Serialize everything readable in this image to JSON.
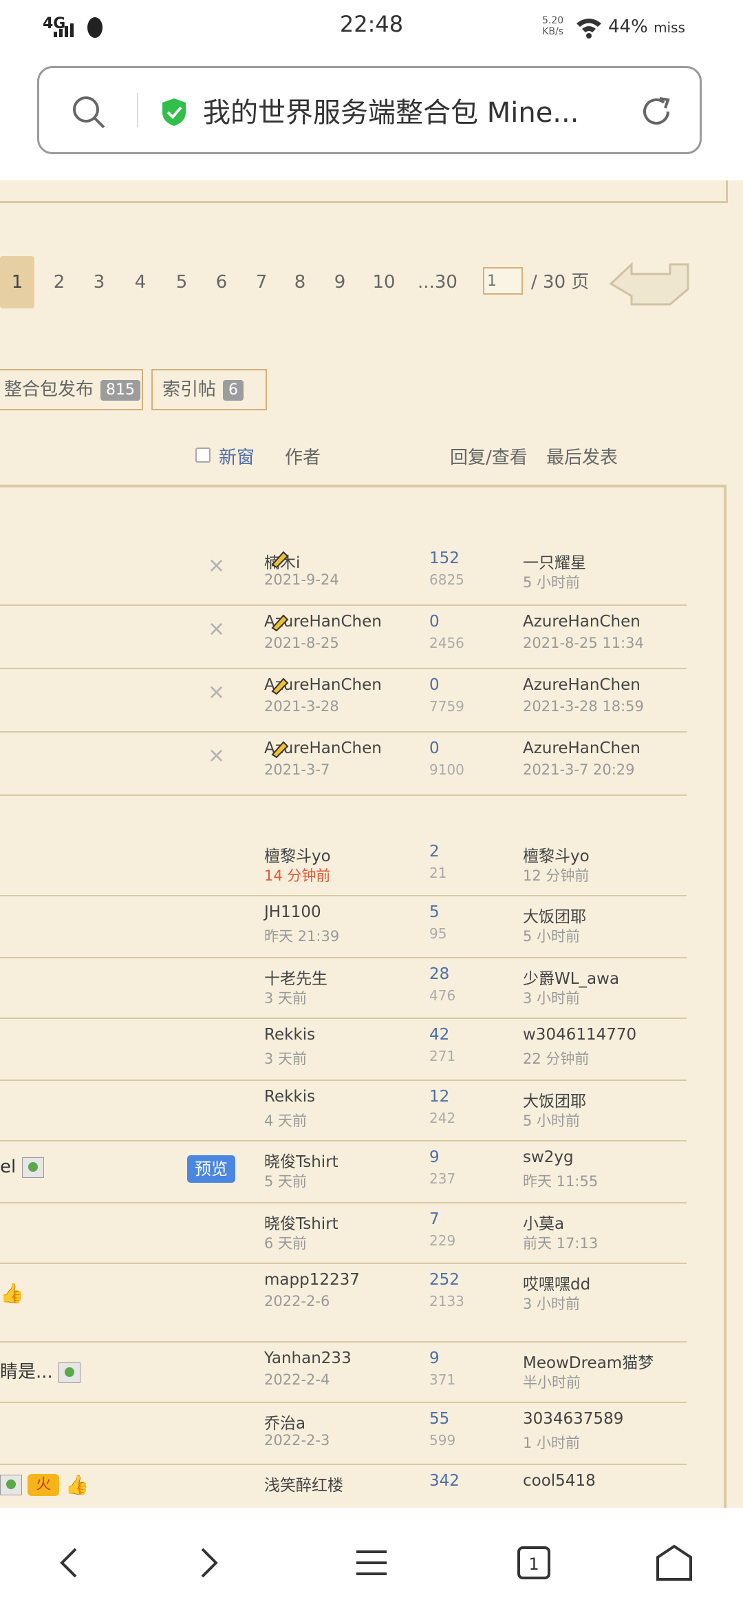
{
  "status": {
    "network": "4G",
    "time": "22:48",
    "speed_value": "5.20",
    "speed_unit": "KB/s",
    "battery": "44%",
    "extra": "miss"
  },
  "urlbar": {
    "title": "我的世界服务端整合包 Mine...",
    "shield_color": "#2fbf4a"
  },
  "pager": {
    "pages": [
      "1",
      "2",
      "3",
      "4",
      "5",
      "6",
      "7",
      "8",
      "9",
      "10",
      "...30"
    ],
    "current": "1",
    "input_value": "1",
    "total": "/ 30 页"
  },
  "chips": [
    {
      "label": "整合包发布",
      "count": "815"
    },
    {
      "label": "索引帖",
      "count": "6"
    }
  ],
  "header": {
    "new_window": "新窗",
    "author": "作者",
    "reply_view": "回复/查看",
    "last_post": "最后发表"
  },
  "rows": [
    {
      "author": "楠木i",
      "date": "2021-9-24",
      "replies": "152",
      "views": "6825",
      "last_user": "一只耀星",
      "last_time": "5 小时前",
      "pinned": true
    },
    {
      "author": "AzureHanChen",
      "date": "2021-8-25",
      "replies": "0",
      "views": "2456",
      "last_user": "AzureHanChen",
      "last_time": "2021-8-25 11:34",
      "pinned": true
    },
    {
      "author": "AzureHanChen",
      "date": "2021-3-28",
      "replies": "0",
      "views": "7759",
      "last_user": "AzureHanChen",
      "last_time": "2021-3-28 18:59",
      "pinned": true
    },
    {
      "author": "AzureHanChen",
      "date": "2021-3-7",
      "replies": "0",
      "views": "9100",
      "last_user": "AzureHanChen",
      "last_time": "2021-3-7 20:29",
      "pinned": true
    },
    {
      "author": "檀黎斗yo",
      "date": "14 分钟前",
      "hot": true,
      "replies": "2",
      "views": "21",
      "last_user": "檀黎斗yo",
      "last_time": "12 分钟前"
    },
    {
      "author": "JH1100",
      "date": "昨天 21:39",
      "replies": "5",
      "views": "95",
      "last_user": "大饭团耶",
      "last_time": "5 小时前"
    },
    {
      "author": "十老先生",
      "date": "3 天前",
      "replies": "28",
      "views": "476",
      "last_user": "少爵WL_awa",
      "last_time": "3 小时前"
    },
    {
      "author": "Rekkis",
      "date": "3 天前",
      "replies": "42",
      "views": "271",
      "last_user": "w3046114770",
      "last_time": "22 分钟前"
    },
    {
      "author": "Rekkis",
      "date": "4 天前",
      "replies": "12",
      "views": "242",
      "last_user": "大饭团耶",
      "last_time": "5 小时前"
    },
    {
      "author": "晓俊Tshirt",
      "date": "5 天前",
      "replies": "9",
      "views": "237",
      "last_user": "sw2yg",
      "last_time": "昨天 11:55",
      "title_frag": "el",
      "preview": "预览"
    },
    {
      "author": "晓俊Tshirt",
      "date": "6 天前",
      "replies": "7",
      "views": "229",
      "last_user": "小莫a",
      "last_time": "前天 17:13"
    },
    {
      "author": "mapp12237",
      "date": "2022-2-6",
      "replies": "252",
      "views": "2133",
      "last_user": "哎嘿嘿dd",
      "last_time": "3 小时前"
    },
    {
      "author": "Yanhan233",
      "date": "2022-2-4",
      "replies": "9",
      "views": "371",
      "last_user": "MeowDream猫梦",
      "last_time": "半小时前",
      "title_frag": "睛是..."
    },
    {
      "author": "乔治a",
      "date": "2022-2-3",
      "replies": "55",
      "views": "599",
      "last_user": "3034637589",
      "last_time": "1 小时前"
    },
    {
      "author": "浅笑醉红楼",
      "date": "",
      "replies": "342",
      "views": "",
      "last_user": "cool5418",
      "last_time": "",
      "fire": "火"
    }
  ]
}
